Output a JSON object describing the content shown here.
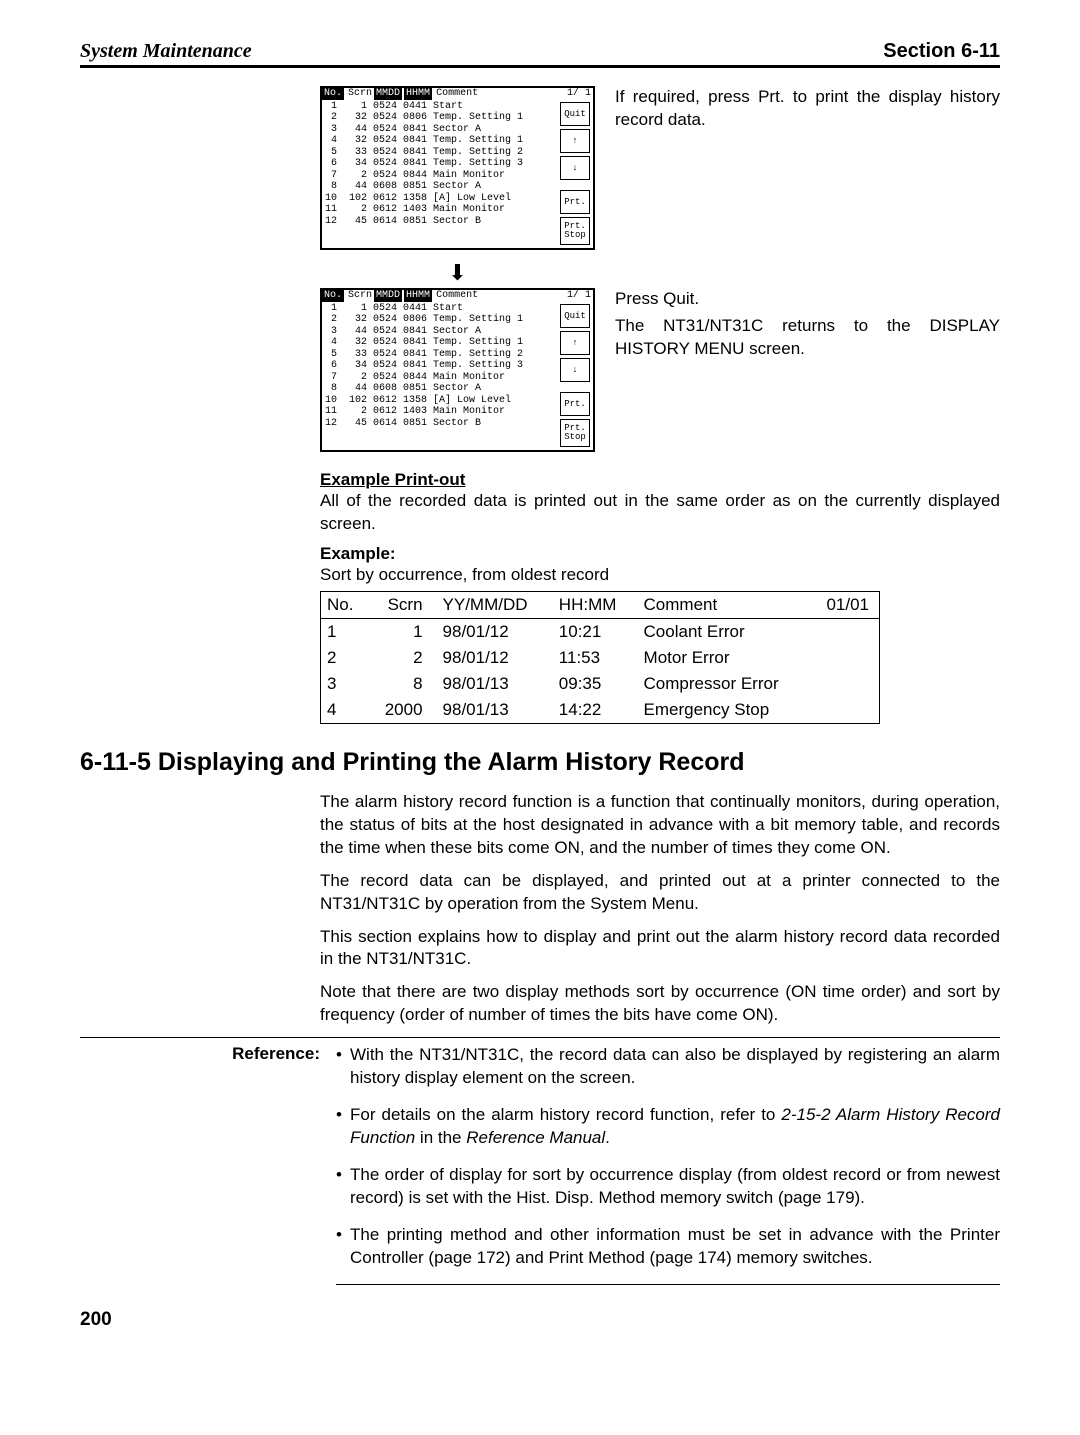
{
  "header": {
    "left": "System Maintenance",
    "right": "Section   6-11"
  },
  "screen_header": {
    "c1": "No.",
    "c2": "Scrn",
    "c3": "MMDD",
    "c4": "HHMM",
    "c5": "Comment",
    "page": "1/ 1"
  },
  "screen_rows": " 1    1 0524 0441 Start\n 2   32 0524 0806 Temp. Setting 1\n 3   44 0524 0841 Sector A\n 4   32 0524 0841 Temp. Setting 1\n 5   33 0524 0841 Temp. Setting 2\n 6   34 0524 0841 Temp. Setting 3\n 7    2 0524 0844 Main Monitor\n 8   44 0608 0851 Sector A\n10  102 0612 1358 [A] Low Level\n11    2 0612 1403 Main Monitor\n12   45 0614 0851 Sector B",
  "btn": {
    "quit": "Quit",
    "up": "↑",
    "down": "↓",
    "prt": "Prt.",
    "prtstop": "Prt.\nStop"
  },
  "step1_text": "If required, press Prt. to print the display history record data.",
  "step2_text1": "Press Quit.",
  "step2_text2": "The NT31/NT31C returns to the DISPLAY HISTORY MENU screen.",
  "example_heading": "Example Print-out",
  "example_body": "All of the recorded data is printed out in the same order as on the currently displayed screen.",
  "example_label": "Example:",
  "example_sort": "Sort by occurrence, from oldest record",
  "tbl": {
    "h": [
      "No.",
      "Scrn",
      "YY/MM/DD",
      "HH:MM",
      "Comment",
      "01/01"
    ],
    "r": [
      [
        "1",
        "1",
        "98/01/12",
        "10:21",
        "Coolant Error"
      ],
      [
        "2",
        "2",
        "98/01/12",
        "11:53",
        "Motor Error"
      ],
      [
        "3",
        "8",
        "98/01/13",
        "09:35",
        "Compressor Error"
      ],
      [
        "4",
        "2000",
        "98/01/13",
        "14:22",
        "Emergency Stop"
      ]
    ]
  },
  "section_title": "6-11-5 Displaying and Printing the Alarm History Record",
  "paras": [
    "The alarm history record function is a function that continually monitors, during operation, the status of bits at the host designated in advance with a bit memory table, and records the time when these bits come ON, and the number of times they come ON.",
    "The record data can be displayed, and printed out at a printer connected to the NT31/NT31C by operation from the System Menu.",
    "This section explains how to display and print out the alarm history record data recorded in the NT31/NT31C.",
    "Note that there are two display methods sort by occurrence (ON time order) and sort by frequency (order of number of times the bits have come ON)."
  ],
  "reference_label": "Reference:",
  "refs": [
    {
      "pre": "With the NT31/NT31C, the record data can also be displayed by registering an alarm history display element on the screen."
    },
    {
      "pre": "For details on the alarm history record function, refer to ",
      "ital": "2-15-2 Alarm History Record Function",
      "mid": " in the ",
      "ital2": "Reference Manual",
      "post": "."
    },
    {
      "pre": "The order of display for sort by occurrence display (from oldest record or from newest record) is set with the Hist. Disp. Method memory switch (page 179)."
    },
    {
      "pre": "The printing method and other information must be set in advance with the Printer Controller (page 172) and Print Method (page 174) memory switches."
    }
  ],
  "page_number": "200"
}
